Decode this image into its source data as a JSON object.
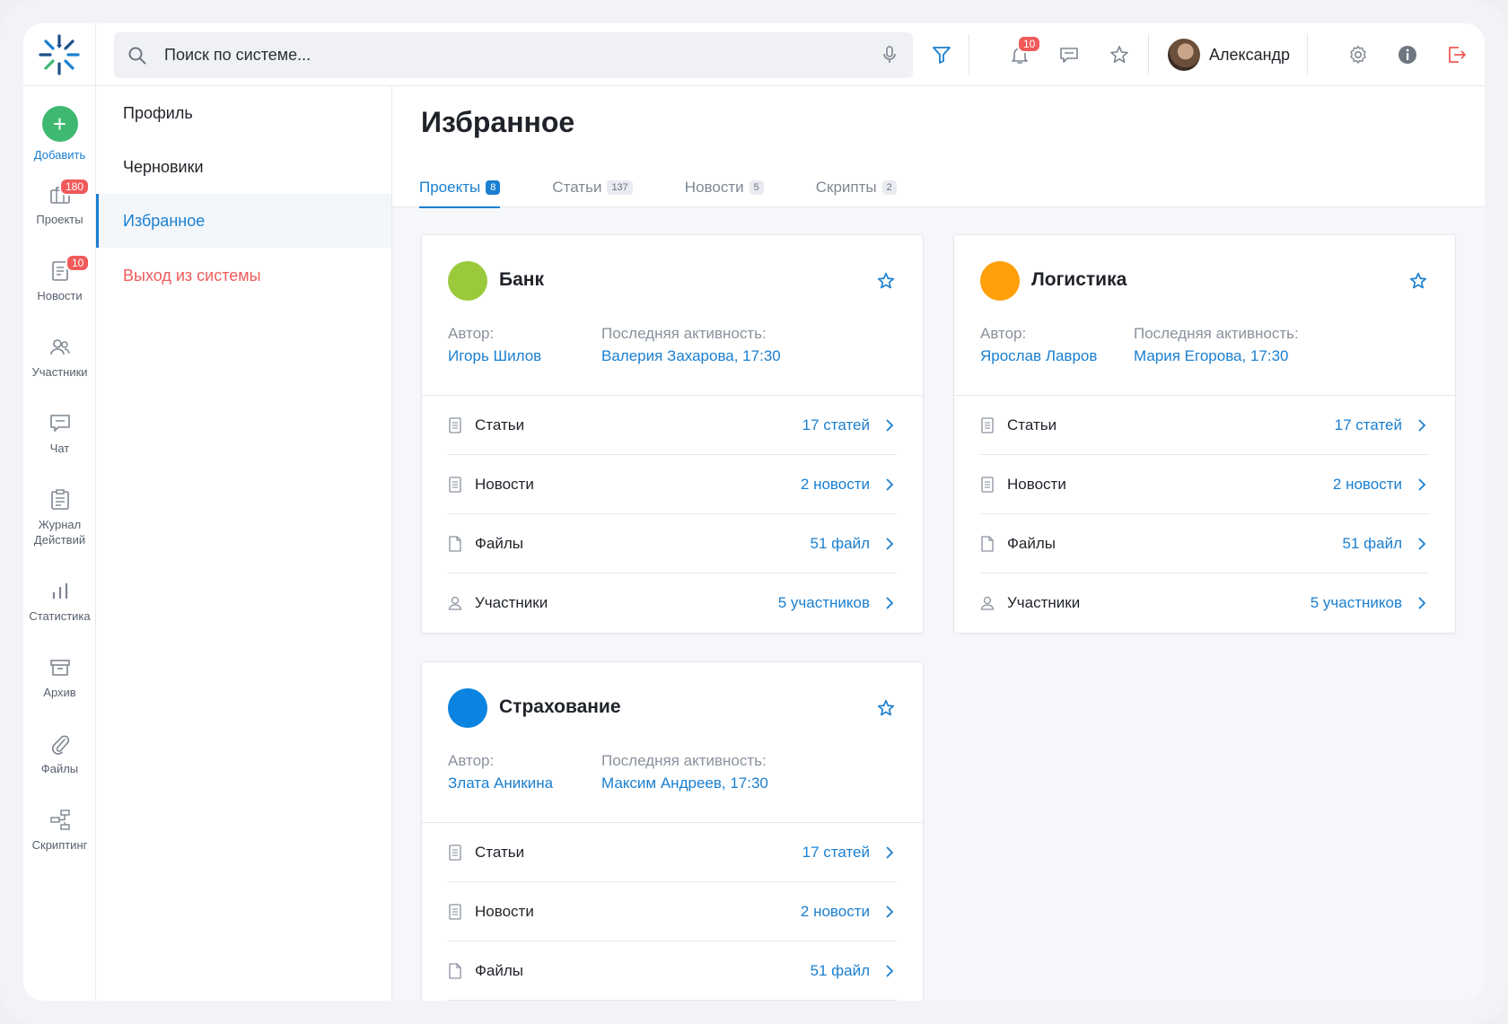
{
  "search": {
    "placeholder": "Поиск по системе..."
  },
  "topbar": {
    "notifications_badge": "10",
    "user_name": "Александр"
  },
  "rail": {
    "add_label": "Добавить",
    "items": [
      {
        "label": "Проекты",
        "badge": "180"
      },
      {
        "label": "Новости",
        "badge": "10"
      },
      {
        "label": "Участники"
      },
      {
        "label": "Чат"
      },
      {
        "label": "Журнал Действий"
      },
      {
        "label": "Статистика"
      },
      {
        "label": "Архив"
      },
      {
        "label": "Файлы"
      },
      {
        "label": "Скриптинг"
      }
    ]
  },
  "submenu": {
    "items": [
      "Профиль",
      "Черновики",
      "Избранное",
      "Выход из системы"
    ]
  },
  "main": {
    "title": "Избранное",
    "tabs": [
      {
        "label": "Проекты",
        "count": "8"
      },
      {
        "label": "Статьи",
        "count": "137"
      },
      {
        "label": "Новости",
        "count": "5"
      },
      {
        "label": "Скрипты",
        "count": "2"
      }
    ]
  },
  "labels": {
    "author": "Автор:",
    "last_activity": "Последняя активность:"
  },
  "projects": [
    {
      "name": "Банк",
      "color": "#9bc93c",
      "author": "Игорь Шилов",
      "activity": "Валерия Захарова, 17:30",
      "rows": [
        {
          "label": "Статьи",
          "value": "17 статей"
        },
        {
          "label": "Новости",
          "value": "2 новости"
        },
        {
          "label": "Файлы",
          "value": "51 файл"
        },
        {
          "label": "Участники",
          "value": "5 участников"
        }
      ]
    },
    {
      "name": "Логистика",
      "color": "#ff9f0a",
      "author": "Ярослав Лавров",
      "activity": "Мария Егорова, 17:30",
      "rows": [
        {
          "label": "Статьи",
          "value": "17 статей"
        },
        {
          "label": "Новости",
          "value": "2 новости"
        },
        {
          "label": "Файлы",
          "value": "51 файл"
        },
        {
          "label": "Участники",
          "value": "5 участников"
        }
      ]
    },
    {
      "name": "Страхование",
      "color": "#0a84e0",
      "author": "Злата Аникина",
      "activity": "Максим Андреев, 17:30",
      "rows": [
        {
          "label": "Статьи",
          "value": "17 статей"
        },
        {
          "label": "Новости",
          "value": "2 новости"
        },
        {
          "label": "Файлы",
          "value": "51 файл"
        }
      ]
    }
  ],
  "colors": {
    "accent": "#1a7fd0",
    "danger": "#ef5a5a",
    "add": "#3fb872"
  }
}
